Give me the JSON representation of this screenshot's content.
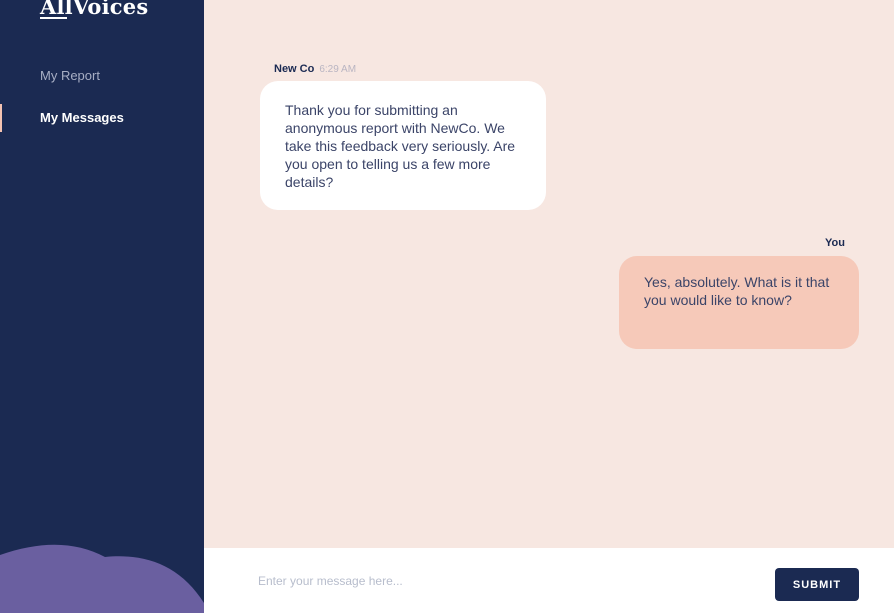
{
  "app": {
    "logo": "AllVoices",
    "accent_color": "#1b2a52",
    "background_color": "#f7e7e1"
  },
  "sidebar": {
    "items": [
      {
        "label": "My Report",
        "active": false
      },
      {
        "label": "My Messages",
        "active": true
      }
    ]
  },
  "conversation": {
    "messages": [
      {
        "sender": "New Co",
        "time": "6:29 AM",
        "text": "Thank you for submitting an anonymous report with NewCo. We take this feedback very seriously. Are you open to telling us a few more details?"
      },
      {
        "sender": "You",
        "text": "Yes, absolutely. What is it that you would like to know?"
      }
    ]
  },
  "composer": {
    "placeholder": "Enter your message here...",
    "value": "",
    "submit_label": "SUBMIT"
  }
}
